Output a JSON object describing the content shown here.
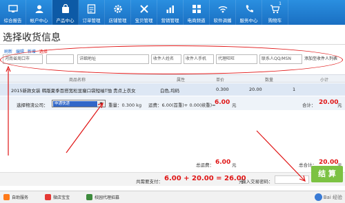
{
  "nav": {
    "items": [
      {
        "icon": "monitor-icon",
        "label": "综合报告"
      },
      {
        "icon": "user-icon",
        "label": "帐户中心"
      },
      {
        "icon": "bag-icon",
        "label": "产品中心"
      },
      {
        "icon": "order-icon",
        "label": "订单管理"
      },
      {
        "icon": "gear-icon",
        "label": "店铺管理"
      },
      {
        "icon": "tools-icon",
        "label": "宝贝管理"
      },
      {
        "icon": "chart-icon",
        "label": "营销管理"
      },
      {
        "icon": "grid-icon",
        "label": "电商频道"
      },
      {
        "icon": "wifi-icon",
        "label": "软件调播"
      },
      {
        "icon": "phone-icon",
        "label": "服务中心"
      },
      {
        "icon": "cart-icon",
        "label": "购物车"
      }
    ],
    "active_index": 2,
    "cart_count": "1"
  },
  "page": {
    "title": "选择收货信息"
  },
  "address": {
    "links": [
      "刷新",
      "编辑",
      "新增",
      "选择"
    ],
    "fields": [
      "河南省周口市",
      "",
      "详细地址",
      "收件人姓名",
      "收件人手机",
      "代理旺旺",
      "联系人QQ/MSN"
    ],
    "add_link": "添加至收件人列表"
  },
  "table": {
    "headers": [
      "商品名称",
      "属性",
      "单价",
      "数量",
      "小计"
    ],
    "rows": [
      {
        "name": "2015新款女装 韩版夏季百搭宽松显瘦口袋短袖T恤 贵点上衣女",
        "attr": "白色,均码",
        "price": "0.300",
        "qty": "20.00",
        "subtotal": "1"
      }
    ]
  },
  "logistics": {
    "label": "选择物流公司：",
    "selected": "申通快递",
    "weight_text": "重量：0.300 kg",
    "fee_text": "运费：6.00(首重)+ 0.00(续重)=",
    "fee_value": "6.00",
    "unit": "元",
    "total_label": "合计：",
    "total_value": "20.00"
  },
  "totals": {
    "total_freight_label": "总运费：",
    "total_freight_value": "6.00",
    "unit": "元",
    "total_label": "总合计：",
    "total_value": "20.00",
    "pay_label": "共需要支付：",
    "pay_formula": "6.00 + 20.00 = 26.00",
    "captcha_label": "输入交易密码：",
    "submit_label": "结 算"
  },
  "bottombar": {
    "items": [
      "自助服务",
      "微店宝宝",
      "校园代理招募"
    ],
    "watermark": "Bai 经验"
  },
  "colors": {
    "nav": "#1a6fc2",
    "accent_red": "#e01515",
    "submit": "#7cc243"
  }
}
